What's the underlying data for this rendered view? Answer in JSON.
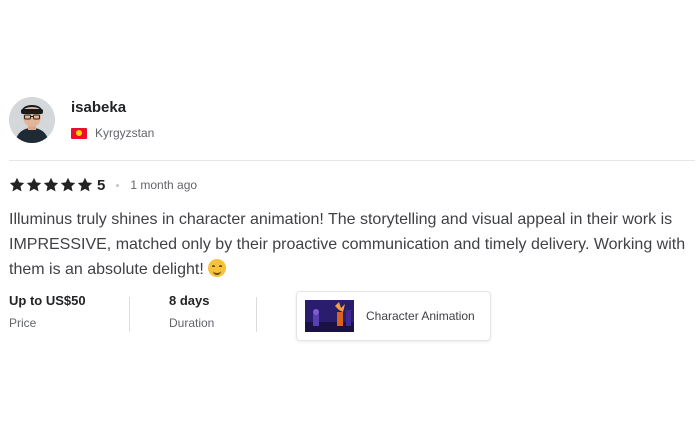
{
  "reviewer": {
    "username": "isabeka",
    "country": "Kyrgyzstan"
  },
  "rating": {
    "stars": 5,
    "value": "5",
    "time_ago": "1 month ago"
  },
  "review": {
    "text": "Illuminus truly shines in character animation! The storytelling and visual appeal in their work is IMPRESSIVE, matched only by their proactive communication and timely delivery. Working with them is an absolute delight!"
  },
  "meta": {
    "price_value": "Up to US$50",
    "price_label": "Price",
    "duration_value": "8 days",
    "duration_label": "Duration"
  },
  "gig": {
    "title": "Character Animation"
  },
  "colors": {
    "star": "#222325",
    "text": "#404145",
    "muted": "#62646a",
    "flag_red": "#e8112d"
  },
  "icons": {
    "flag": "kyrgyzstan-flag-icon",
    "star": "star-icon",
    "emoji": "star-struck-emoji-icon"
  }
}
